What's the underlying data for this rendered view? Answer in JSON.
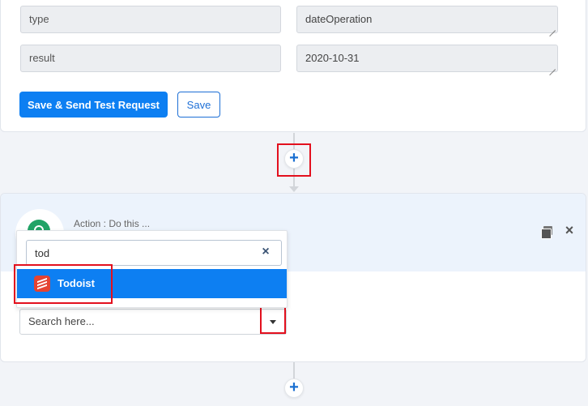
{
  "form": {
    "rows": [
      {
        "label": "type",
        "value": "dateOperation"
      },
      {
        "label": "result",
        "value": "2020-10-31"
      }
    ],
    "save_send_label": "Save & Send Test Request",
    "save_label": "Save"
  },
  "action": {
    "title": "Action : Do this ...",
    "search": {
      "query": "tod",
      "placeholder": "Search here..."
    },
    "options": [
      {
        "label": "Todoist",
        "icon": "todoist-icon"
      }
    ]
  },
  "colors": {
    "primary": "#0d7ff2",
    "highlight": "#e3101e",
    "todoist": "#e44332"
  },
  "icons": [
    "plus-icon",
    "copy-icon",
    "close-icon",
    "clear-icon",
    "caret-down-icon",
    "todoist-icon"
  ]
}
